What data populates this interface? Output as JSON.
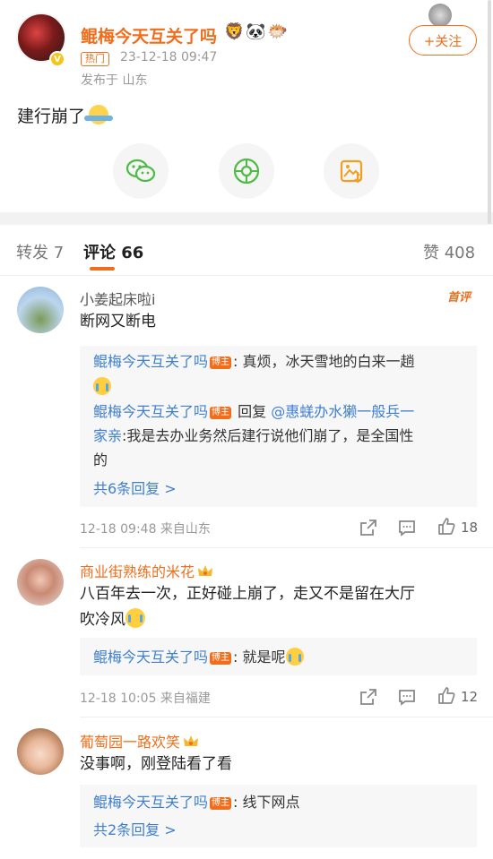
{
  "post": {
    "author": "鲲梅今天互关了吗",
    "hot_tag": "热门",
    "time": "23-12-18 09:47",
    "location": "发布于 山东",
    "follow_label": "+关注",
    "text": "建行崩了"
  },
  "tabs": {
    "repost": "转发 7",
    "comments": "评论 66",
    "likes": "赞 408"
  },
  "comments": [
    {
      "name": "小姜起床啦i",
      "first_badge": "首评",
      "text": "断网又断电",
      "replies": [
        {
          "author": "鲲梅今天互关了吗",
          "badge": "博主",
          "text1": ": 真烦，冰天雪地的白来一趟"
        },
        {
          "author": "鲲梅今天互关了吗",
          "badge": "博主",
          "reply_word": " 回复 ",
          "target": "@惠蜣办水獭一般兵一",
          "line2": "家亲",
          "text2": ":我是去办业务然后建行说他们崩了，是全国性",
          "line3": "的"
        }
      ],
      "more": "共6条回复 >",
      "meta": "12-18 09:48  来自山东",
      "likes": "18"
    },
    {
      "name": "商业街熟练的米花",
      "text_line1": "八百年去一次，正好碰上崩了，走又不是留在大厅",
      "text_line2": "吹冷风",
      "reply": {
        "author": "鲲梅今天互关了吗",
        "badge": "博主",
        "text": ": 就是呢"
      },
      "meta": "12-18 10:05  来自福建",
      "likes": "12"
    },
    {
      "name": "葡萄园一路欢笑",
      "text": "没事啊，刚登陆看了看",
      "reply": {
        "author": "鲲梅今天互关了吗",
        "badge": "博主",
        "text": ": 线下网点"
      },
      "more": "共2条回复 >"
    }
  ],
  "colors": {
    "accent": "#f06e1b",
    "link": "#3f7fd1"
  }
}
